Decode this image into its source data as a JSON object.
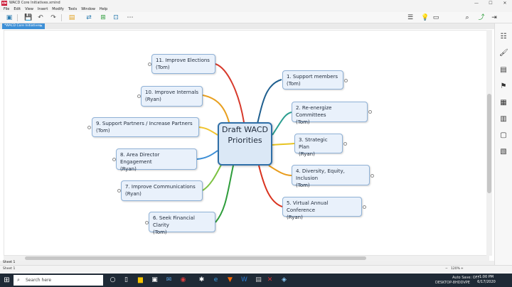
{
  "window": {
    "app_logo": "XM",
    "title": "WACD Core Initiatives.xmind",
    "minimize": "—",
    "maximize": "☐",
    "close": "✕"
  },
  "menu": [
    "File",
    "Edit",
    "View",
    "Insert",
    "Modify",
    "Tools",
    "Window",
    "Help"
  ],
  "tab": {
    "label": "*WACD Core Initiatives",
    "close": "✕"
  },
  "map": {
    "central": {
      "line1": "Draft",
      "line2": "WACD",
      "line3": "Priorities"
    },
    "topics": [
      {
        "id": "t1",
        "title": "1. Support members",
        "owner": "(Tom)",
        "color": "#1f5f8f"
      },
      {
        "id": "t2",
        "title": "2. Re-energize Committees",
        "owner": "(Tom)",
        "color": "#2a9d8f"
      },
      {
        "id": "t3",
        "title": "3. Strategic Plan",
        "owner": "(Ryan)",
        "color": "#e7c421"
      },
      {
        "id": "t4",
        "title": "4. Diversity, Equity, Inclusion",
        "owner": "(Tom)",
        "color": "#e89b1a"
      },
      {
        "id": "t5",
        "title": "5. Virtual Annual Conference",
        "owner": "(Ryan)",
        "color": "#d9331f"
      },
      {
        "id": "t6",
        "title": "6. Seek Financial Clarity",
        "owner": "(Tom)",
        "color": "#2e9d3b"
      },
      {
        "id": "t7",
        "title": "7. Improve Communications",
        "owner": "(Ryan)",
        "color": "#7cc242"
      },
      {
        "id": "t8",
        "title": "8. Area Director Engagement",
        "owner": "(Ryan)",
        "color": "#3d8fd6"
      },
      {
        "id": "t9",
        "title": "9. Support Partners / Increase Partners",
        "owner": "(Tom)",
        "color": "#f1c42e"
      },
      {
        "id": "t10",
        "title": "10. Improve Internals",
        "owner": "(Ryan)",
        "color": "#e8a020"
      },
      {
        "id": "t11",
        "title": "11. Improve Elections",
        "owner": "(Tom)",
        "color": "#d73a2c"
      }
    ]
  },
  "sheetbar": {
    "label": "Sheet 1",
    "tab": "Sheet 1"
  },
  "status": {
    "autosave": "Auto Save: OFF",
    "user": "DESKTOP-8HDDVPE",
    "zoom": "120%",
    "zoom_minus": "−",
    "zoom_plus": "+"
  },
  "taskbar": {
    "search_placeholder": "Search here",
    "time": "1:00 PM",
    "date": "6/17/2020"
  }
}
